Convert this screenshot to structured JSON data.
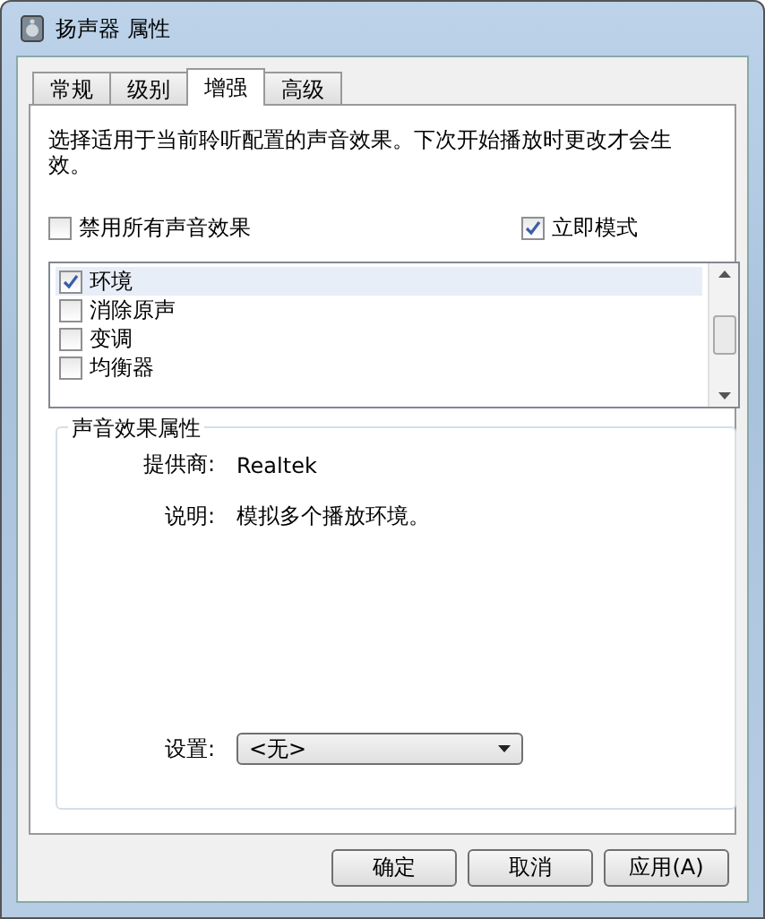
{
  "window": {
    "title": "扬声器 属性"
  },
  "tabs": [
    {
      "label": "常规",
      "selected": false
    },
    {
      "label": "级别",
      "selected": false
    },
    {
      "label": "增强",
      "selected": true
    },
    {
      "label": "高级",
      "selected": false
    }
  ],
  "description": "选择适用于当前聆听配置的声音效果。下次开始播放时更改才会生效。",
  "disable_all": {
    "label": "禁用所有声音效果",
    "checked": false
  },
  "immediate_mode": {
    "label": "立即模式",
    "checked": true
  },
  "effects": [
    {
      "label": "环境",
      "checked": true,
      "selected": true
    },
    {
      "label": "消除原声",
      "checked": false,
      "selected": false
    },
    {
      "label": "变调",
      "checked": false,
      "selected": false
    },
    {
      "label": "均衡器",
      "checked": false,
      "selected": false
    }
  ],
  "properties": {
    "title": "声音效果属性",
    "provider_label": "提供商:",
    "provider": "Realtek",
    "description_label": "说明:",
    "description": "模拟多个播放环境。",
    "setting_label": "设置:",
    "setting": "<无>"
  },
  "buttons": [
    "确定",
    "取消",
    "应用(A)"
  ]
}
